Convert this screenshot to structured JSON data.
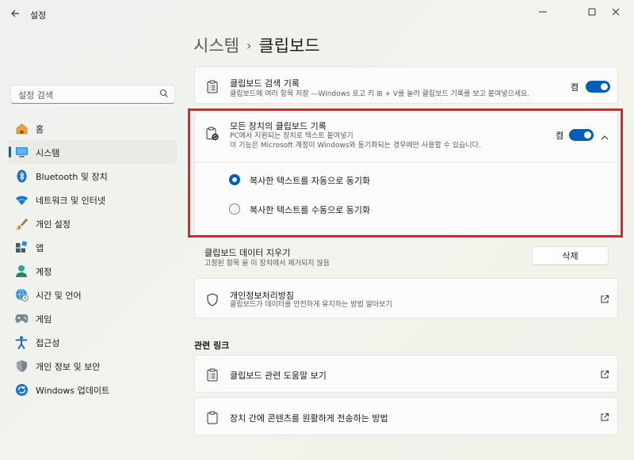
{
  "window": {
    "app_title": "설정",
    "back_icon": "back-arrow-icon",
    "controls": [
      "minimize-icon",
      "maximize-icon",
      "close-icon"
    ]
  },
  "search": {
    "placeholder": "설정 검색",
    "icon": "search-icon"
  },
  "sidebar": {
    "items": [
      {
        "label": "홈",
        "icon": "home-icon",
        "active": false
      },
      {
        "label": "시스템",
        "icon": "system-monitor-icon",
        "active": true
      },
      {
        "label": "Bluetooth 및 장치",
        "icon": "bluetooth-icon",
        "active": false
      },
      {
        "label": "네트워크 및 인터넷",
        "icon": "wifi-icon",
        "active": false
      },
      {
        "label": "개인 설정",
        "icon": "paintbrush-icon",
        "active": false
      },
      {
        "label": "앱",
        "icon": "apps-icon",
        "active": false
      },
      {
        "label": "계정",
        "icon": "account-icon",
        "active": false
      },
      {
        "label": "시간 및 언어",
        "icon": "globe-clock-icon",
        "active": false
      },
      {
        "label": "게임",
        "icon": "gamepad-icon",
        "active": false
      },
      {
        "label": "접근성",
        "icon": "accessibility-icon",
        "active": false
      },
      {
        "label": "개인 정보 및 보안",
        "icon": "shield-icon",
        "active": false
      },
      {
        "label": "Windows 업데이트",
        "icon": "update-icon",
        "active": false
      }
    ]
  },
  "header": {
    "parent": "시스템",
    "separator": "›",
    "title": "클립보드"
  },
  "clipboard_history": {
    "title": "클립보드 검색 기록",
    "description": "클립보드에 여러 항목 저장 —Windows 로고 키 ⊞ + V를 눌러 클립보드 기록를 보고 붙여넣으세요.",
    "toggle_label": "켬",
    "toggle_on": true
  },
  "sync_across_devices": {
    "title": "모든 장치의 클립보드 기록",
    "description_1": "PC에서 지원되는 장치로 텍스트 붙여넣기",
    "description_2": "이 기능은 Microsoft 계정이 Windows와 동기화되는 경우에만 사용할 수 있습니다.",
    "toggle_label": "켬",
    "toggle_on": true,
    "expanded": true,
    "options": [
      {
        "label": "복사한 텍스트를 자동으로 동기화",
        "selected": true
      },
      {
        "label": "복사한 텍스트를 수동으로 동기화",
        "selected": false
      }
    ]
  },
  "clear_data": {
    "title": "클립보드 데이터 지우기",
    "description": "고정된 항목 을 이 장치에서 제거되지 않음",
    "button_label": "삭제"
  },
  "privacy": {
    "title": "개인정보처리방침",
    "description": "클립보드가 데이터를 안전하게 유지하는 방법 알아보기"
  },
  "related": {
    "heading": "관련 링크",
    "links": [
      {
        "label": "클립보드 관련 도움말 보기",
        "icon": "clipboard-list-icon"
      },
      {
        "label": "장치 간에 콘텐츠를 원활하게 전송하는 방법",
        "icon": "clipboard-icon"
      }
    ]
  },
  "colors": {
    "accent": "#005fb8",
    "highlight_border": "#d9272e"
  }
}
